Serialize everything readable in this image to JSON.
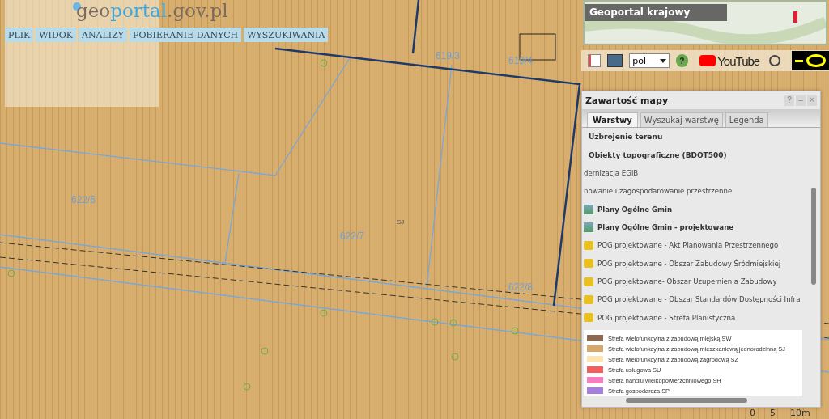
{
  "header": {
    "logo": {
      "part_1": "geo",
      "part_2": "portal",
      "part_3": ".gov.pl"
    },
    "menu": [
      {
        "label": "PLIK"
      },
      {
        "label": "WIDOK"
      },
      {
        "label": "ANALIZY"
      },
      {
        "label": "POBIERANIE DANYCH"
      },
      {
        "label": "WYSZUKIWANIA"
      }
    ]
  },
  "map": {
    "parcel_labels": [
      {
        "text": "619/3"
      },
      {
        "text": "619/4"
      },
      {
        "text": "622/6"
      },
      {
        "text": "622/7"
      },
      {
        "text": "622/8"
      },
      {
        "text": "SJ"
      }
    ],
    "scale": [
      "0",
      "5",
      "10m"
    ]
  },
  "overview": {
    "title": "Geoportal krajowy"
  },
  "toolbar": {
    "language": "pol",
    "help": "?",
    "video_logo": "YouTube"
  },
  "panel": {
    "title": "Zawartość mapy",
    "controls": [
      "?",
      "–",
      "×"
    ],
    "tabs": [
      {
        "label": "Warstwy",
        "selected": true
      },
      {
        "label": "Wyszukaj warstwę",
        "selected": false
      },
      {
        "label": "Legenda",
        "selected": false
      }
    ],
    "layers": [
      {
        "kind": "group",
        "label": "Uzbrojenie terenu"
      },
      {
        "kind": "group",
        "label": "Obiekty topograficzne (BDOT500)"
      },
      {
        "kind": "plain",
        "label": "dernizacja EGiB"
      },
      {
        "kind": "plain",
        "label": "nowanie i zagospodarowanie przestrzenne"
      },
      {
        "kind": "service",
        "label": "Plany Ogólne Gmin"
      },
      {
        "kind": "service",
        "label": "Plany Ogólne Gmin - projektowane"
      },
      {
        "kind": "folder",
        "label": "POG projektowane - Akt Planowania Przestrzennego"
      },
      {
        "kind": "folder",
        "label": "POG projektowane - Obszar Zabudowy Śródmiejskiej"
      },
      {
        "kind": "folder",
        "label": "POG projektowane- Obszar Uzupełnienia Zabudowy"
      },
      {
        "kind": "folder",
        "label": "POG projektowane - Obszar Standardów Dostępności Infra"
      },
      {
        "kind": "folder",
        "label": "POG projektowane - Strefa Planistyczna"
      }
    ],
    "legend": [
      {
        "label": "Strefa wielofunkcyjna z zabudową miejską SW",
        "color": "#8c6a52"
      },
      {
        "label": "Strefa wielofunkcyjna z zabudową mieszkaniową jednorodzinną SJ",
        "color": "#d6a96b"
      },
      {
        "label": "Strefa wielofunkcyjna z zabudową zagrodową SZ",
        "color": "#fde4b3"
      },
      {
        "label": "Strefa usługowa SU",
        "color": "#f25f5c"
      },
      {
        "label": "Strefa handlu wielkopowierzchniowego SH",
        "color": "#f77fc0"
      },
      {
        "label": "Strefa gospodarcza SP",
        "color": "#a57ee0"
      }
    ]
  }
}
